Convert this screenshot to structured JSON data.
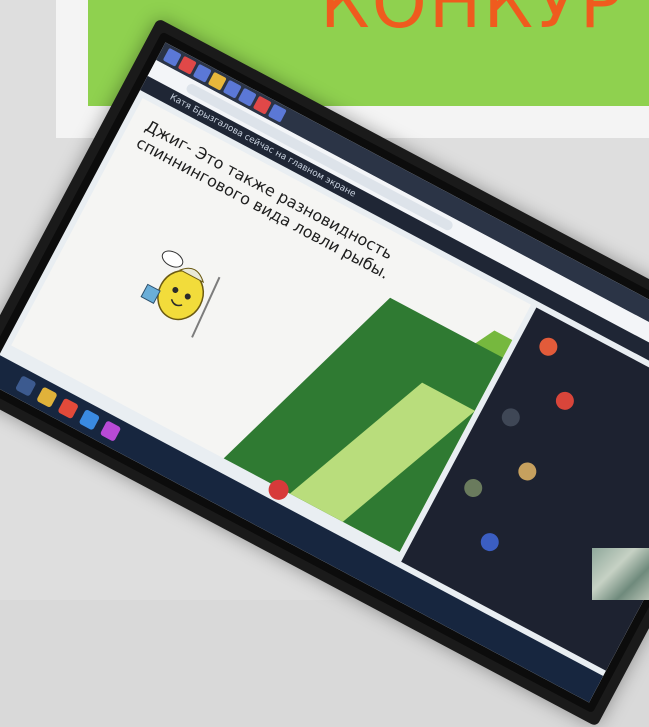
{
  "banner": {
    "text": "КОНКУР"
  },
  "photo": {
    "screen": {
      "presenter_notice": "Катя Брызгалова сейчас на главном экране",
      "slide_title": "Джиг- Это также разновидность спиннингового вида ловли рыбы."
    }
  },
  "colors": {
    "banner_green": "#8fd14f",
    "banner_text": "#ef5b1e",
    "slide_green_dark": "#2f7a32",
    "slide_green_light": "#76b83e"
  }
}
